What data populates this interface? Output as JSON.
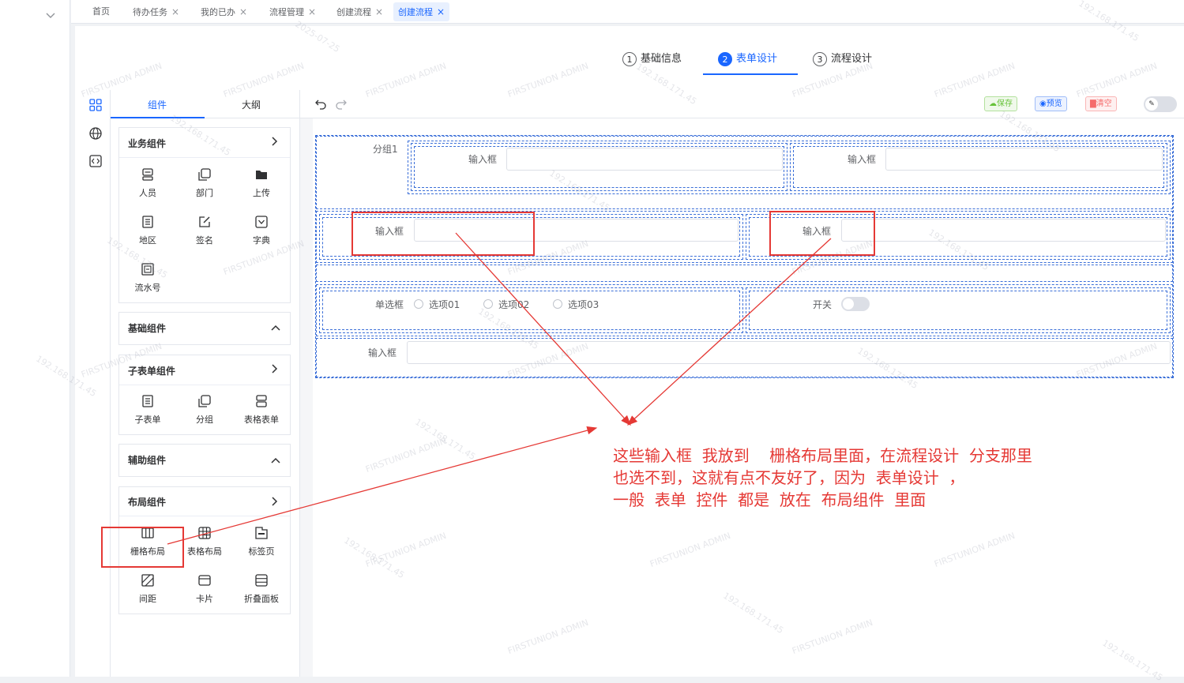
{
  "tabs": [
    {
      "label": "首页",
      "closable": false
    },
    {
      "label": "待办任务",
      "closable": true
    },
    {
      "label": "我的已办",
      "closable": true
    },
    {
      "label": "流程管理",
      "closable": true
    },
    {
      "label": "创建流程",
      "closable": true
    },
    {
      "label": "创建流程",
      "closable": true,
      "active": true
    }
  ],
  "close_glyph": "×",
  "steps": [
    {
      "num": "1",
      "label": "基础信息"
    },
    {
      "num": "2",
      "label": "表单设计",
      "active": true
    },
    {
      "num": "3",
      "label": "流程设计"
    }
  ],
  "panel_tabs": {
    "components": "组件",
    "outline": "大纲"
  },
  "groups": {
    "business": {
      "title": "业务组件",
      "items": [
        {
          "label": "人员",
          "icon": "person-icon"
        },
        {
          "label": "部门",
          "icon": "department-icon"
        },
        {
          "label": "上传",
          "icon": "upload-folder-icon"
        },
        {
          "label": "地区",
          "icon": "region-icon"
        },
        {
          "label": "签名",
          "icon": "signature-icon"
        },
        {
          "label": "字典",
          "icon": "dictionary-icon"
        },
        {
          "label": "流水号",
          "icon": "serial-number-icon"
        }
      ]
    },
    "basic": {
      "title": "基础组件"
    },
    "subform": {
      "title": "子表单组件",
      "items": [
        {
          "label": "子表单",
          "icon": "subform-icon"
        },
        {
          "label": "分组",
          "icon": "group-icon"
        },
        {
          "label": "表格表单",
          "icon": "table-form-icon"
        }
      ]
    },
    "auxiliary": {
      "title": "辅助组件"
    },
    "layout": {
      "title": "布局组件",
      "items": [
        {
          "label": "栅格布局",
          "icon": "grid-layout-icon"
        },
        {
          "label": "表格布局",
          "icon": "table-layout-icon"
        },
        {
          "label": "标签页",
          "icon": "tabs-icon"
        },
        {
          "label": "间距",
          "icon": "spacing-icon"
        },
        {
          "label": "卡片",
          "icon": "card-icon"
        },
        {
          "label": "折叠面板",
          "icon": "collapse-panel-icon"
        }
      ]
    }
  },
  "toolbar": {
    "save": "保存",
    "preview": "预览",
    "clear": "清空"
  },
  "form": {
    "group_label": "分组1",
    "input_label": "输入框",
    "radio_label": "单选框",
    "radio_options": [
      "选项01",
      "选项02",
      "选项03"
    ],
    "switch_label": "开关"
  },
  "annotation": {
    "line1": "这些输入框  我放到    栅格布局里面，在流程设计  分支那里",
    "line2": "也选不到，这就有点不友好了，因为  表单设计  ，",
    "line3": "一般  表单  控件  都是  放在  布局组件  里面"
  },
  "watermark": {
    "ip": "192.168.171.45",
    "mark": "▨▨",
    "date": "2025-07-25",
    "org": "FIRSTUNION ADMIN"
  },
  "colors": {
    "accent": "#1a66ff",
    "annotation_red": "#e53935",
    "save_green": "#67c23a",
    "clear_red": "#f56c6c"
  }
}
